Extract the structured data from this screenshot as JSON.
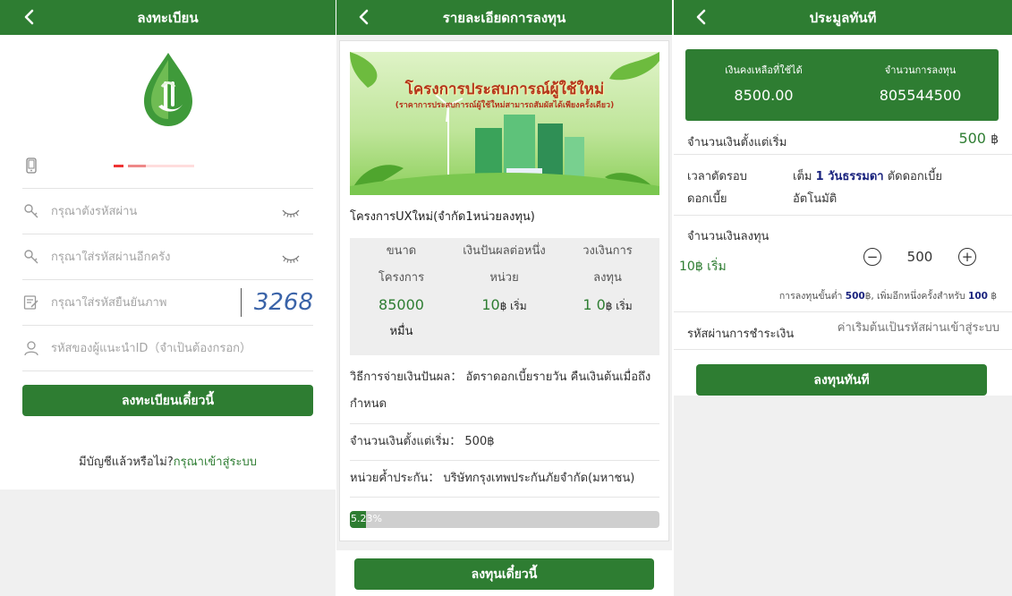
{
  "panel1": {
    "title": "ลงทะเบียน",
    "password_placeholder": "กรุณาตั้งรหัสผ่าน",
    "confirm_placeholder": "กรุณาใส่รหัสผ่านอีกครั้ง",
    "captcha_placeholder": "กรุณาใส่รหัสยืนยันภาพ",
    "captcha_code": "3268",
    "referrer_placeholder": "รหัสของผู้แนะนำID（จำเป็นต้องกรอก）",
    "register_button": "ลงทะเบียนเดี๋ยวนี้",
    "login_prompt": "มีบัญชีแล้วหรือไม่?",
    "login_link": "กรุณาเข้าสู่ระบบ"
  },
  "panel2": {
    "title": "รายละเอียดการลงทุน",
    "banner_line1": "โครงการประสบการณ์ผู้ใช้ใหม่",
    "banner_line2": "(ราคาการประสบการณ์ผู้ใช้ใหม่สามารถสัมผัสได้เพียงครั้งเดียว)",
    "project_title": "โครงการUXใหม่(จำกัด1หน่วยลงทุน)",
    "stat1_label_a": "ขนาด",
    "stat1_label_b": "โครงการ",
    "stat1_value": "85000",
    "stat1_unit": "หมื่น",
    "stat2_label_a": "เงินปันผลต่อหนึ่ง",
    "stat2_label_b": "หน่วย",
    "stat2_value": "10",
    "stat2_unit": "฿ เริ่ม",
    "stat3_label_a": "วงเงินการ",
    "stat3_label_b": "ลงทุน",
    "stat3_value": "1 0",
    "stat3_unit": "฿ เริ่ม",
    "payout": "วิธีการจ่ายเงินปันผล：  อัตราดอกเบี้ยรายวัน คืนเงินต้นเมื่อถึงกำหนด",
    "min_amount": "จำนวนเงินตั้งแต่เริ่ม：  500฿",
    "guarantor": "หน่วยค้ำประกัน：  บริษัทกรุงเทพประกันภัยจำกัด(มหาชน)",
    "progress_percent": 5.23,
    "progress_text": "5.23%",
    "invest_button": "ลงทุนเดี๋ยวนี้"
  },
  "panel3": {
    "title": "ประมูลทันที",
    "balance_label": "เงินคงเหลือที่ใช้ได้",
    "balance_value": "8500.00",
    "invest_count_label": "จำนวนการลงทุน",
    "invest_count_value": "805544500",
    "start_amount_label": "จำนวนเงินตั้งแต่เริ่ม",
    "start_amount_value": "500",
    "currency": "฿",
    "cutoff_label_a": "เวลาตัดรอบ",
    "cutoff_label_b": "ดอกเบี้ย",
    "cutoff_prefix": "เต็ม",
    "cutoff_highlight": "1 วันธรรมดา",
    "cutoff_suffix": "ตัดดอกเบี้ย",
    "cutoff_line2": "อัตโนมัติ",
    "amount_label": "จำนวนเงินลงทุน",
    "amount_side": "10฿ เริ่ม",
    "stepper_value": "500",
    "rule_prefix": "การลงทุนขั้นต่ำ",
    "rule_min": "500",
    "rule_mid": "฿,  เพิ่มอีกหนึ่งครั้งสำหรับ",
    "rule_step": "100",
    "rule_suffix": "฿",
    "pay_pw_label": "รหัสผ่านการชำระเงิน",
    "pay_pw_placeholder": "ค่าเริ่มต้นเป็นรหัสผ่านเข้าสู่ระบบ",
    "submit_button": "ลงทุนทันที"
  },
  "colors": {
    "brand_green": "#2e7d32",
    "captcha_blue": "#3a63a8",
    "highlight_blue": "#1a237e"
  }
}
